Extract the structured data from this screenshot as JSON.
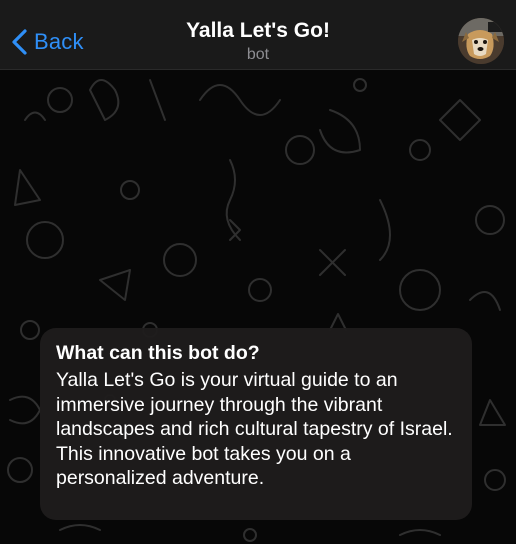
{
  "header": {
    "back_label": "Back",
    "title": "Yalla Let's Go!",
    "subtitle": "bot"
  },
  "icons": {
    "back": "chevron-left-icon",
    "avatar": "bot-avatar-dog-image"
  },
  "intro_card": {
    "heading": "What can this bot do?",
    "description": "Yalla Let's Go is your virtual guide to an immersive journey through the vibrant landscapes and rich cultural tapestry of Israel. This innovative bot takes you on a personalized adventure."
  },
  "colors": {
    "accent": "#2f8ff7",
    "header_bg": "#1a1a1a",
    "chat_bg": "#070707",
    "pattern": "#3a3a3a",
    "card_bg": "#1e1c1c",
    "text_primary": "#ffffff",
    "text_secondary": "#8d8d92"
  }
}
